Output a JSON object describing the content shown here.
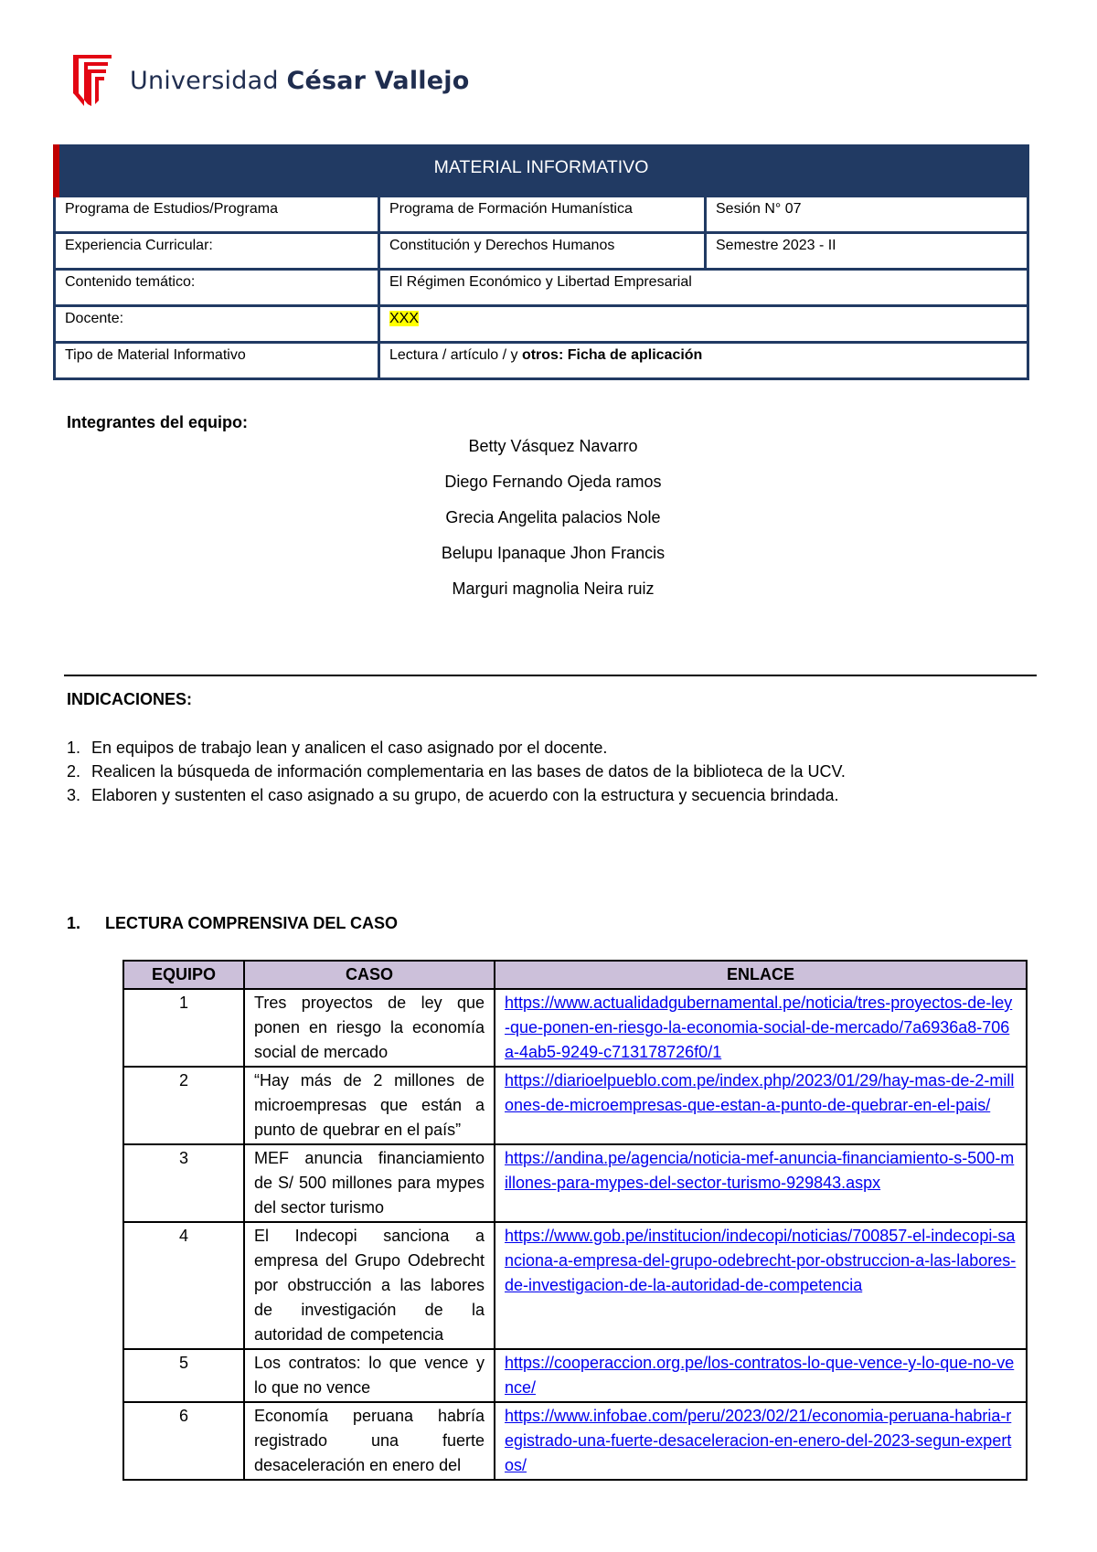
{
  "header": {
    "university_light": "Universidad",
    "university_bold": "César Vallejo",
    "brand_red": "#e30613",
    "brand_navy": "#1f2d4f"
  },
  "info_table": {
    "title": "MATERIAL INFORMATIVO",
    "rows": [
      {
        "label": "Programa de Estudios/Programa",
        "value": "Programa de Formación Humanística",
        "extra": "Sesión N° 07"
      },
      {
        "label": "Experiencia Curricular:",
        "value": "Constitución y Derechos Humanos",
        "extra": "Semestre 2023 - II"
      },
      {
        "label": "Contenido temático:",
        "value": "El Régimen Económico y Libertad Empresarial"
      },
      {
        "label": "Docente:",
        "value": "XXX"
      },
      {
        "label": "Tipo de Material Informativo",
        "value_plain": "Lectura / artículo / y ",
        "value_bold": "otros: Ficha de aplicación"
      }
    ]
  },
  "team": {
    "label": "Integrantes del equipo:",
    "members": [
      "Betty Vásquez Navarro",
      "Diego Fernando Ojeda ramos",
      "Grecia Angelita palacios Nole",
      "Belupu Ipanaque Jhon Francis",
      "Marguri magnolia Neira ruiz"
    ]
  },
  "indicaciones": {
    "title": "INDICACIONES:",
    "items": [
      {
        "n": "1.",
        "text": "En equipos de trabajo lean y analicen el caso asignado por el docente."
      },
      {
        "n": "2.",
        "text": "Realicen la búsqueda de información complementaria en las bases de datos de la biblioteca de la UCV."
      },
      {
        "n": "3.",
        "text": "Elaboren y sustenten el caso asignado a su grupo, de acuerdo con la estructura y secuencia brindada."
      }
    ]
  },
  "section": {
    "number": "1.",
    "title": "LECTURA COMPRENSIVA DEL CASO"
  },
  "cases_table": {
    "headers": [
      "EQUIPO",
      "CASO",
      "ENLACE"
    ],
    "rows": [
      {
        "equipo": "1",
        "caso": "Tres proyectos de ley que ponen en riesgo la economía social de mercado",
        "enlace": "https://www.actualidadgubernamental.pe/noticia/tres-proyectos-de-ley-que-ponen-en-riesgo-la-economia-social-de-mercado/7a6936a8-706a-4ab5-9249-c713178726f0/1"
      },
      {
        "equipo": "2",
        "caso": "“Hay más de 2 millones de microempresas que están a punto de quebrar en el país”",
        "enlace": "https://diarioelpueblo.com.pe/index.php/2023/01/29/hay-mas-de-2-millones-de-microempresas-que-estan-a-punto-de-quebrar-en-el-pais/"
      },
      {
        "equipo": "3",
        "caso": "MEF anuncia financiamiento de S/ 500 millones para mypes del sector turismo",
        "enlace": "https://andina.pe/agencia/noticia-mef-anuncia-financiamiento-s-500-millones-para-mypes-del-sector-turismo-929843.aspx"
      },
      {
        "equipo": "4",
        "caso": "El Indecopi sanciona a empresa del Grupo Odebrecht por obstrucción a las labores de investigación de la autoridad de competencia",
        "enlace": "https://www.gob.pe/institucion/indecopi/noticias/700857-el-indecopi-sanciona-a-empresa-del-grupo-odebrecht-por-obstruccion-a-las-labores-de-investigacion-de-la-autoridad-de-competencia"
      },
      {
        "equipo": "5",
        "caso": "Los contratos: lo que vence y lo que no vence",
        "enlace": "https://cooperaccion.org.pe/los-contratos-lo-que-vence-y-lo-que-no-vence/"
      },
      {
        "equipo": "6",
        "caso": "Economía peruana habría registrado una fuerte desaceleración en enero del",
        "enlace": "https://www.infobae.com/peru/2023/02/21/economia-peruana-habria-registrado-una-fuerte-desaceleracion-en-enero-del-2023-segun-expertos/"
      }
    ]
  }
}
